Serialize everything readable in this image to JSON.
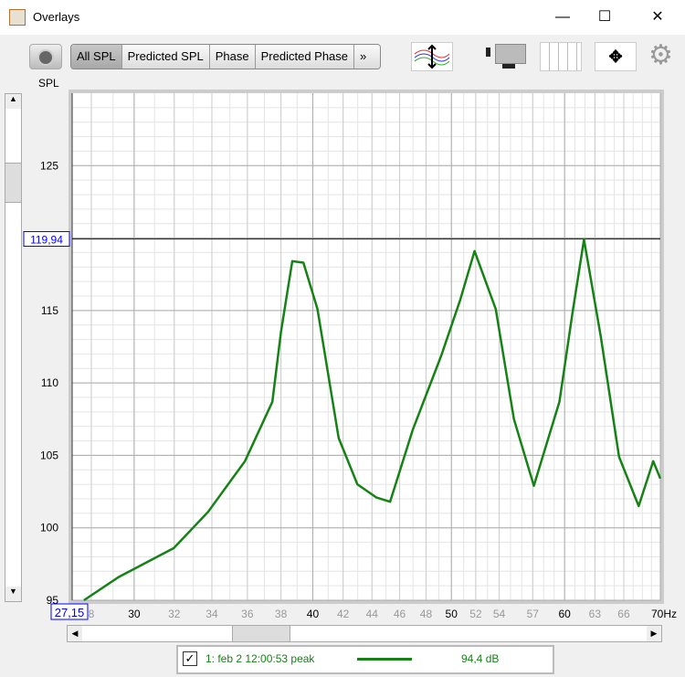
{
  "window": {
    "title": "Overlays",
    "minimize": "—",
    "maximize": "☐",
    "close": "✕"
  },
  "toolbar": {
    "tabs": [
      "All SPL",
      "Predicted SPL",
      "Phase",
      "Predicted Phase",
      "»"
    ],
    "active": 0,
    "icons": [
      "camera-icon",
      "traces-adjust-icon",
      "vertical-resize-icon",
      "columns-icon",
      "pan-arrows-icon",
      "gear-icon"
    ]
  },
  "legend": {
    "checked": true,
    "label": "1: feb 2 12:00:53 peak",
    "value": "94,4 dB",
    "color": "#168216"
  },
  "cursor": {
    "y_readout": "119,94",
    "x_readout": "27,15"
  },
  "chart_data": {
    "type": "line",
    "ylabel": "SPL",
    "xunit": "Hz",
    "xscale": "log",
    "xlim": [
      27.15,
      70
    ],
    "ylim": [
      95,
      130
    ],
    "grid": true,
    "xticks": [
      {
        "v": 28,
        "l": "8",
        "major": false
      },
      {
        "v": 30,
        "l": "30",
        "major": true
      },
      {
        "v": 32,
        "l": "32"
      },
      {
        "v": 34,
        "l": "34"
      },
      {
        "v": 36,
        "l": "36"
      },
      {
        "v": 38,
        "l": "38"
      },
      {
        "v": 40,
        "l": "40",
        "major": true
      },
      {
        "v": 42,
        "l": "42"
      },
      {
        "v": 44,
        "l": "44"
      },
      {
        "v": 46,
        "l": "46"
      },
      {
        "v": 48,
        "l": "48"
      },
      {
        "v": 50,
        "l": "50",
        "major": true
      },
      {
        "v": 52,
        "l": "52"
      },
      {
        "v": 54,
        "l": "54"
      },
      {
        "v": 57,
        "l": "57"
      },
      {
        "v": 60,
        "l": "60",
        "major": true
      },
      {
        "v": 63,
        "l": "63"
      },
      {
        "v": 66,
        "l": "66"
      },
      {
        "v": 70,
        "l": "70Hz",
        "major": true
      }
    ],
    "yticks": [
      95,
      100,
      105,
      110,
      115,
      120,
      125
    ],
    "yticks_labeled": [
      "95",
      "100",
      "105",
      "110",
      "115",
      "",
      "125"
    ],
    "cursor_y": 119.94,
    "series": [
      {
        "color": "#168216",
        "x": [
          27.67,
          29.26,
          31.98,
          33.79,
          35.86,
          37.48,
          38.0,
          38.7,
          39.4,
          40.3,
          41.7,
          42.98,
          44.3,
          45.3,
          47.0,
          49.2,
          50.7,
          51.9,
          53.7,
          55.3,
          57.1,
          59.5,
          60.8,
          61.9,
          63.6,
          65.5,
          67.6,
          69.2,
          70.0
        ],
        "y": [
          95.0,
          96.6,
          98.6,
          101.1,
          104.6,
          108.7,
          113.5,
          118.4,
          118.3,
          115.1,
          106.2,
          103.0,
          102.1,
          101.8,
          106.8,
          111.9,
          115.7,
          119.1,
          115.1,
          107.5,
          102.9,
          108.7,
          115.0,
          119.9,
          113.2,
          104.9,
          101.5,
          104.6,
          103.4
        ]
      }
    ]
  }
}
